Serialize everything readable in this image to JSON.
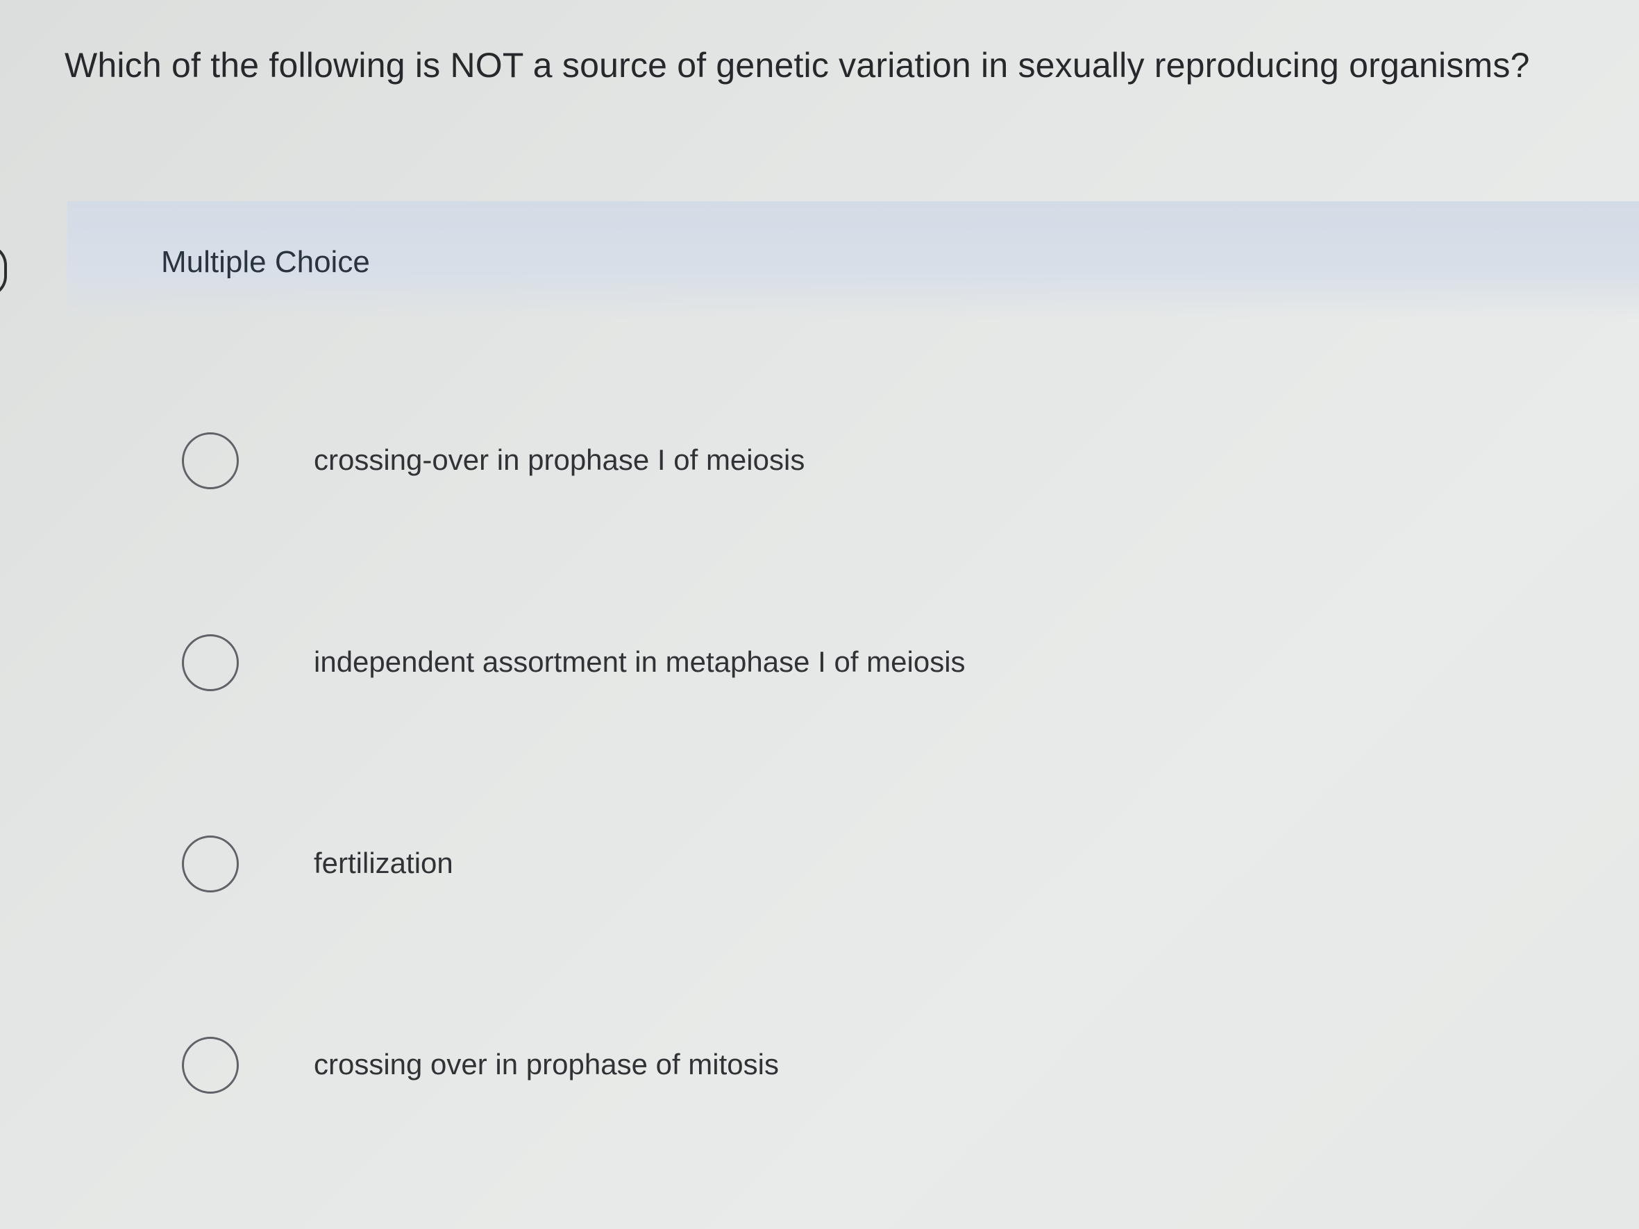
{
  "question": {
    "text": "Which of the following is NOT a source of genetic variation in sexually reproducing organisms?"
  },
  "section": {
    "label": "Multiple Choice"
  },
  "choices": [
    {
      "label": "crossing-over in prophase I of meiosis"
    },
    {
      "label": "independent assortment in metaphase I of meiosis"
    },
    {
      "label": "fertilization"
    },
    {
      "label": "crossing over in prophase of mitosis"
    }
  ]
}
